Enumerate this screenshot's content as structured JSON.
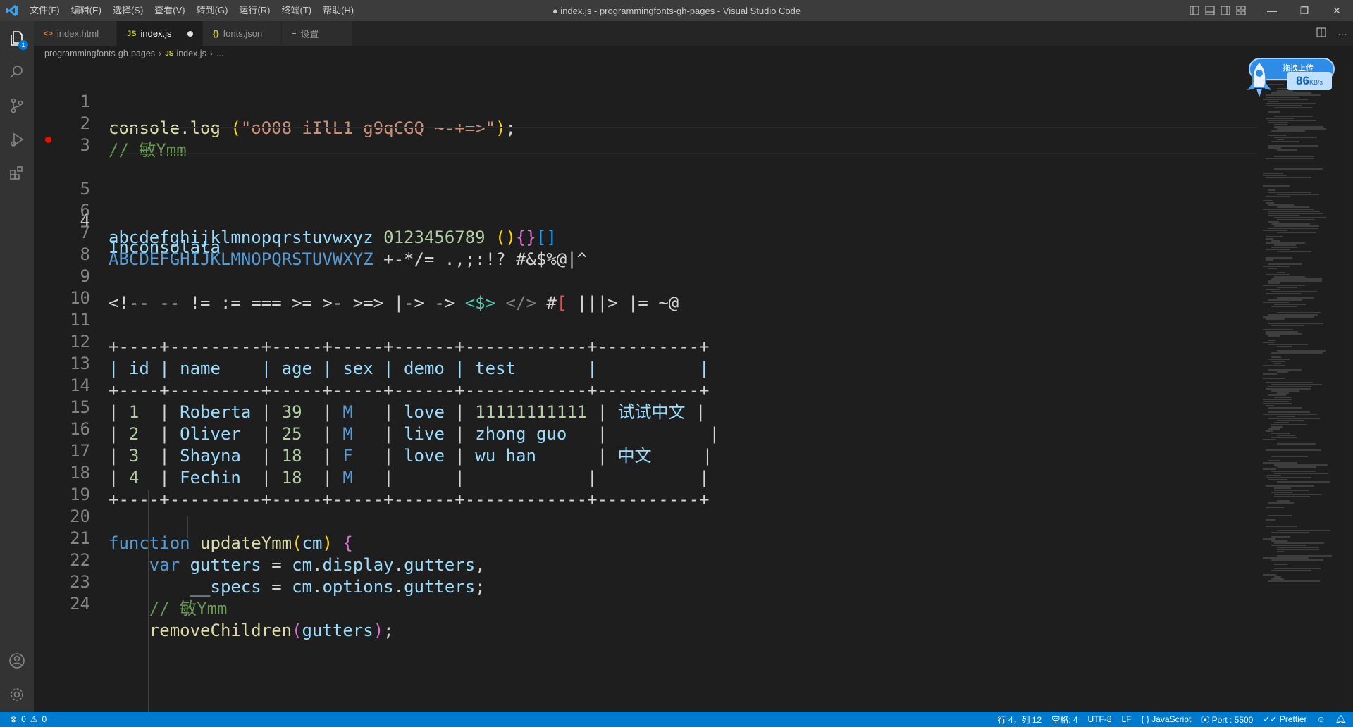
{
  "titlebar": {
    "menu": [
      "文件(F)",
      "编辑(E)",
      "选择(S)",
      "查看(V)",
      "转到(G)",
      "运行(R)",
      "终端(T)",
      "帮助(H)"
    ],
    "window_title": "● index.js - programmingfonts-gh-pages - Visual Studio Code"
  },
  "activity": {
    "explorer_badge": "1"
  },
  "tabs": [
    {
      "label": "index.html",
      "icon": "<>",
      "active": false
    },
    {
      "label": "index.js",
      "icon": "JS",
      "active": true,
      "modified": true
    },
    {
      "label": "fonts.json",
      "icon": "{}",
      "active": false
    },
    {
      "label": "设置",
      "icon": "≡",
      "active": false
    }
  ],
  "breadcrumb": {
    "folder": "programmingfonts-gh-pages",
    "file": "index.js",
    "more": "..."
  },
  "editor": {
    "current_line": 4,
    "lines": [
      {
        "n": "1"
      },
      {
        "n": "2"
      },
      {
        "n": "3"
      },
      {
        "n": "4"
      },
      {
        "n": "5"
      },
      {
        "n": "6"
      },
      {
        "n": "7"
      },
      {
        "n": "8"
      },
      {
        "n": "9"
      },
      {
        "n": "10"
      },
      {
        "n": "11"
      },
      {
        "n": "12"
      },
      {
        "n": "13"
      },
      {
        "n": "14"
      },
      {
        "n": "15"
      },
      {
        "n": "16"
      },
      {
        "n": "17"
      },
      {
        "n": "18"
      },
      {
        "n": "19"
      },
      {
        "n": "20"
      },
      {
        "n": "21"
      },
      {
        "n": "22"
      },
      {
        "n": "23"
      },
      {
        "n": "24"
      }
    ],
    "code": {
      "l1": {
        "fn": "console.log",
        "sp": " ",
        "p1": "(",
        "str": "\"oO08 iIlL1 g9qCGQ ~-+=>\"",
        "p2": ")",
        "end": ";"
      },
      "l2": "// 敏Ymm",
      "l4": "Inconsolata",
      "l6": {
        "lower": "abcdefghijklmnopqrstuvwxyz",
        "digits": " 0123456789 ",
        "b1": "()",
        "b2": "{}",
        "b3": "[]"
      },
      "l7": {
        "upper": "ABCDEFGHIJKLMNOPQRSTUVWXYZ",
        "rest": " +-*/= .,;:!? #&$%@|^"
      },
      "l9": {
        "a": "<!-- -- != := === >= >- >=> |-> -> ",
        "b": "<$>",
        "c": " ",
        "d": "</>",
        "e": " #",
        "f": "[",
        "g": " |||> |= ~@"
      },
      "l11": "+----+---------+-----+-----+------+------------+----------+",
      "l12": "| id | name    | age | sex | demo | test       |          |",
      "l13": "+----+---------+-----+-----+------+------------+----------+",
      "l14": {
        "id": "1 ",
        "name": "Roberta",
        "age": "39",
        "sex": "M",
        "demo": "love",
        "test": "11111111111",
        "extra": "试试中文"
      },
      "l15": {
        "id": "2 ",
        "name": "Oliver ",
        "age": "25",
        "sex": "M",
        "demo": "live",
        "test": "zhong guo  ",
        "extra": ""
      },
      "l16": {
        "id": "3 ",
        "name": "Shayna ",
        "age": "18",
        "sex": "F",
        "demo": "love",
        "test": "wu han     ",
        "extra": "中文"
      },
      "l17": {
        "id": "4 ",
        "name": "Fechin ",
        "age": "18",
        "sex": "M",
        "demo": "",
        "test": "",
        "extra": ""
      },
      "l18": "+----+---------+-----+-----+------+------------+----------+",
      "l20": {
        "kw": "function",
        "fn": "updateYmm",
        "p1": "(",
        "arg": "cm",
        "p2": ")",
        "br": "{"
      },
      "l21": {
        "kw": "var",
        "v1": "gutters",
        "eq": " = ",
        "o": "cm",
        "d1": ".",
        "p": "display",
        "d2": ".",
        "q": "gutters",
        "end": ","
      },
      "l22": {
        "v1": "__specs",
        "eq": " = ",
        "o": "cm",
        "d1": ".",
        "p": "options",
        "d2": ".",
        "q": "gutters",
        "end": ";"
      },
      "l23": "// 敏Ymm",
      "l24": {
        "fn": "removeChildren",
        "p1": "(",
        "arg": "gutters",
        "p2": ")",
        "end": ";"
      }
    }
  },
  "upload_widget": {
    "label": "拖拽上传",
    "speed": "86",
    "unit": "KB/s"
  },
  "statusbar": {
    "errors": "0",
    "warnings": "0",
    "position": "行 4，列 12",
    "spaces": "空格: 4",
    "encoding": "UTF-8",
    "eol": "LF",
    "language": "JavaScript",
    "port": "Port : 5500",
    "prettier": "Prettier"
  }
}
